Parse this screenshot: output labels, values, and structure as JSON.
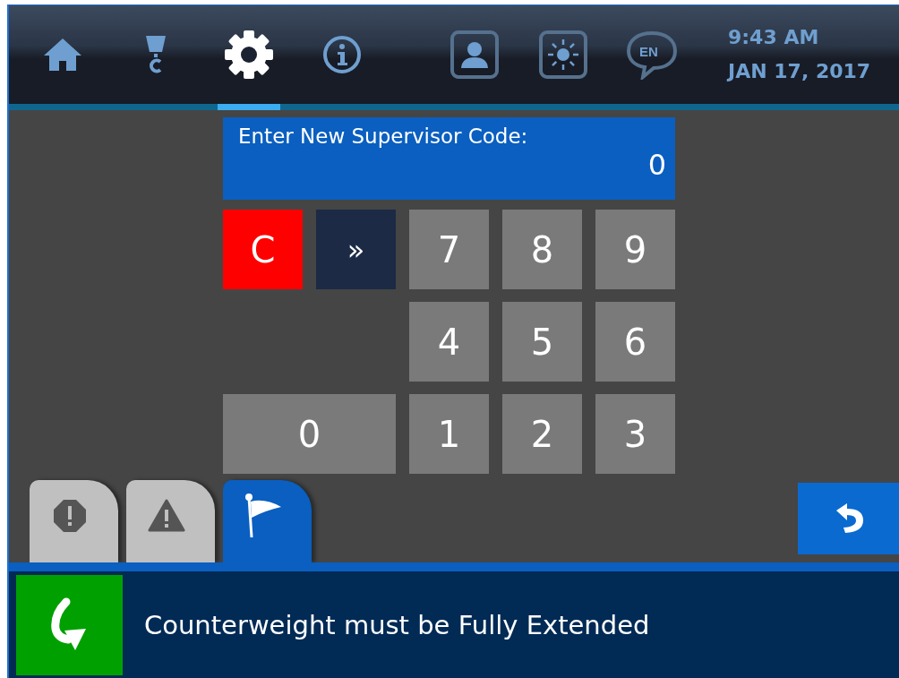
{
  "header": {
    "nav_items": [
      {
        "kind": "home",
        "selected": false
      },
      {
        "kind": "hook",
        "selected": false
      },
      {
        "kind": "settings",
        "selected": true
      },
      {
        "kind": "info",
        "selected": false
      }
    ],
    "tools": [
      {
        "kind": "profile"
      },
      {
        "kind": "brightness"
      },
      {
        "kind": "language",
        "label": "EN"
      }
    ],
    "time": "9:43 AM",
    "date": "JAN 17, 2017"
  },
  "code_entry": {
    "prompt": "Enter New Supervisor Code:",
    "value": "0"
  },
  "keypad": {
    "rows": [
      [
        {
          "kind": "clear",
          "label": "C"
        },
        {
          "kind": "next",
          "label": "»"
        },
        {
          "kind": "digit",
          "label": "7"
        },
        {
          "kind": "digit",
          "label": "8"
        },
        {
          "kind": "digit",
          "label": "9"
        }
      ],
      [
        "",
        "",
        {
          "kind": "digit",
          "label": "4"
        },
        {
          "kind": "digit",
          "label": "5"
        },
        {
          "kind": "digit",
          "label": "6"
        }
      ],
      [
        {
          "kind": "digit",
          "label": "0",
          "colspan": 2
        },
        {
          "kind": "digit",
          "label": "1"
        },
        {
          "kind": "digit",
          "label": "2"
        },
        {
          "kind": "digit",
          "label": "3"
        }
      ]
    ]
  },
  "alert_tabs": [
    {
      "kind": "fault",
      "selected": false
    },
    {
      "kind": "warning",
      "selected": false
    },
    {
      "kind": "notice",
      "selected": true
    }
  ],
  "message": {
    "kind": "turn",
    "text": "Counterweight must be Fully Extended"
  }
}
